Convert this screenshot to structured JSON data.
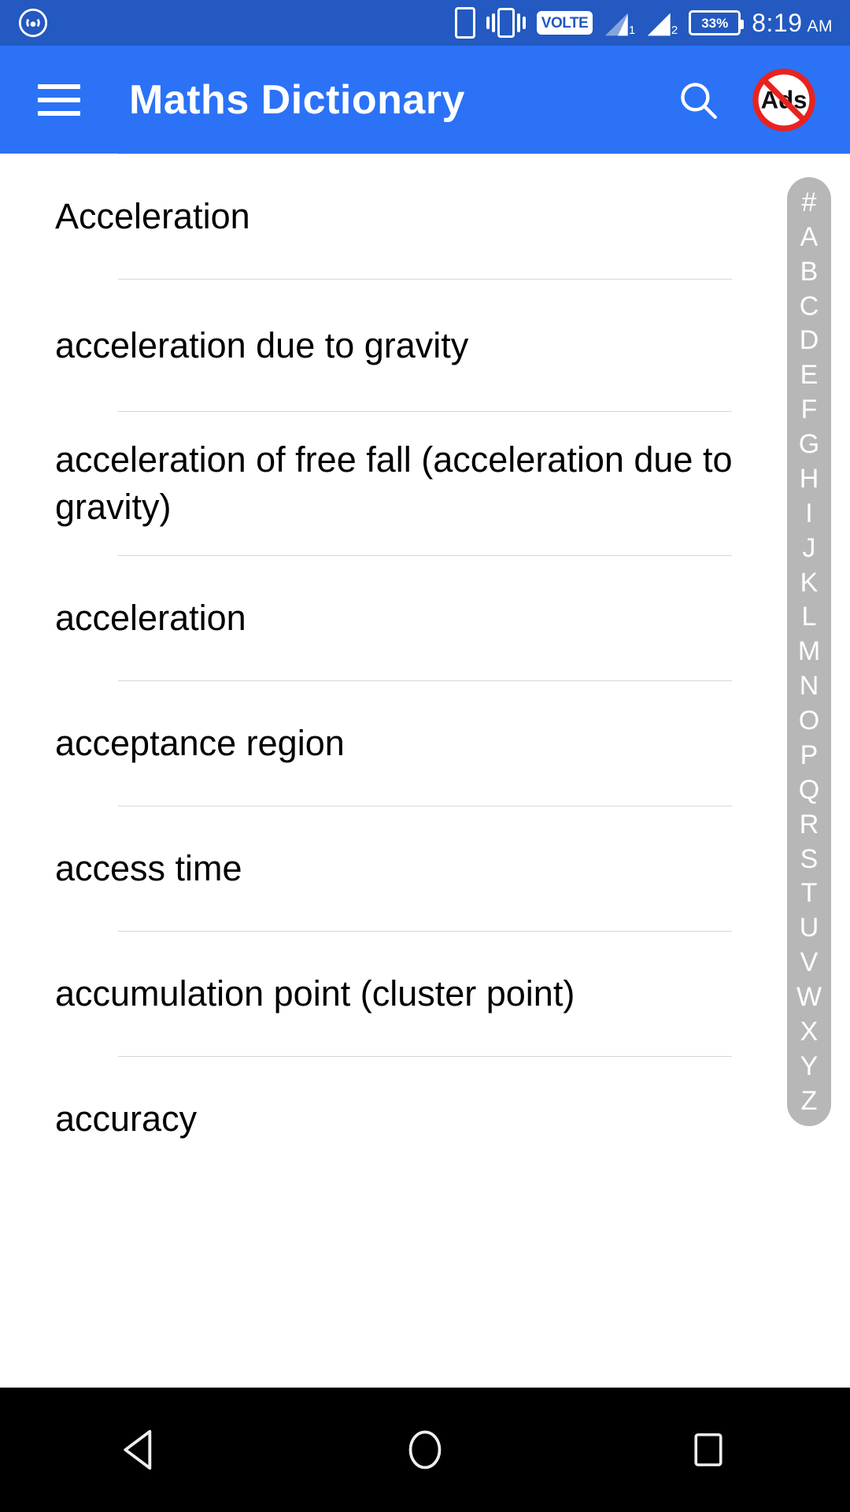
{
  "status_bar": {
    "time": "8:19",
    "ampm": "AM",
    "battery_percent": "33%",
    "volte_label": "VOLTE",
    "sim1_label": "1",
    "sim2_label": "2",
    "icons": [
      "cast-icon",
      "phone-icon",
      "vibrate-icon",
      "volte-icon",
      "signal-sim1-icon",
      "signal-sim2-icon",
      "battery-icon"
    ],
    "background_color": "#2359c0"
  },
  "app_bar": {
    "title": "Maths Dictionary",
    "menu_icon": "hamburger-menu-icon",
    "search_icon": "search-icon",
    "ads_icon": "no-ads-icon",
    "ads_label": "Ads",
    "background_color": "#2b72f7"
  },
  "list": {
    "items": [
      {
        "label": "Acceleration"
      },
      {
        "label": "acceleration due to gravity"
      },
      {
        "label": "acceleration of free fall (acceleration due to gravity)"
      },
      {
        "label": "acceleration"
      },
      {
        "label": "acceptance region"
      },
      {
        "label": "access time"
      },
      {
        "label": "accumulation point (cluster point)"
      },
      {
        "label": "accuracy"
      }
    ]
  },
  "alpha_index": {
    "letters": [
      "#",
      "A",
      "B",
      "C",
      "D",
      "E",
      "F",
      "G",
      "H",
      "I",
      "J",
      "K",
      "L",
      "M",
      "N",
      "O",
      "P",
      "Q",
      "R",
      "S",
      "T",
      "U",
      "V",
      "W",
      "X",
      "Y",
      "Z"
    ],
    "background_color": "#b7b7b7",
    "text_color": "#ffffff"
  },
  "nav_bar": {
    "back": "back-nav-icon",
    "home": "home-nav-icon",
    "recents": "recents-nav-icon",
    "background_color": "#000000"
  }
}
